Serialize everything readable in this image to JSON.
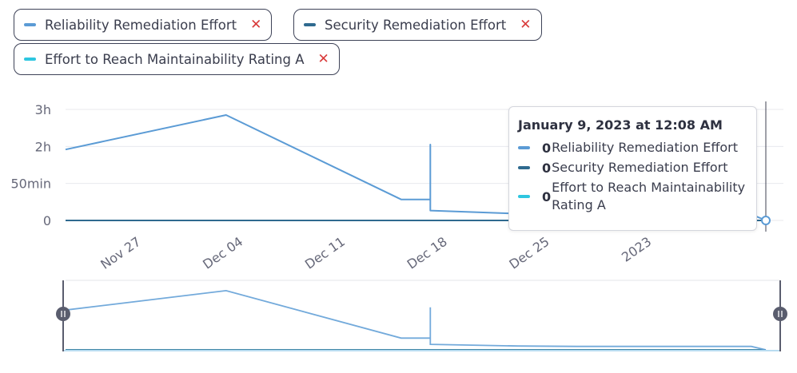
{
  "filters": [
    {
      "label": "Reliability Remediation Effort",
      "color": "#5b9bd5",
      "remove": "✕"
    },
    {
      "label": "Security Remediation Effort",
      "color": "#2f6a8f",
      "remove": "✕"
    },
    {
      "label": "Effort to Reach Maintainability Rating A",
      "color": "#2ec6e0",
      "remove": "✕"
    }
  ],
  "tooltip": {
    "title": "January 9, 2023 at 12:08 AM",
    "rows": [
      {
        "value": "0",
        "label": "Reliability Remediation Effort",
        "color": "#5b9bd5"
      },
      {
        "value": "0",
        "label": "Security Remediation Effort",
        "color": "#2f6a8f"
      },
      {
        "value": "0",
        "label": "Effort to Reach Maintainability Rating A",
        "color": "#2ec6e0"
      }
    ]
  },
  "chart_data": {
    "type": "line",
    "x_range": [
      "2022-11-22",
      "2023-01-09"
    ],
    "y_ticks": [
      {
        "label": "3h",
        "value": 180
      },
      {
        "label": "2h",
        "value": 120
      },
      {
        "label": "50min",
        "value": 60
      },
      {
        "label": "0",
        "value": 0
      }
    ],
    "y_range_minutes": [
      0,
      180
    ],
    "x_ticks": [
      {
        "label": "Nov 27",
        "date": "2022-11-27"
      },
      {
        "label": "Dec 04",
        "date": "2022-12-04"
      },
      {
        "label": "Dec 11",
        "date": "2022-12-11"
      },
      {
        "label": "Dec 18",
        "date": "2022-12-18"
      },
      {
        "label": "Dec 25",
        "date": "2022-12-25"
      },
      {
        "label": "2023",
        "date": "2023-01-01"
      }
    ],
    "grid": true,
    "series": [
      {
        "name": "Reliability Remediation Effort",
        "color": "#5b9bd5",
        "points": [
          [
            "2022-11-22",
            115
          ],
          [
            "2022-12-03",
            171
          ],
          [
            "2022-12-15",
            34
          ],
          [
            "2022-12-17",
            34
          ],
          [
            "2022-12-17",
            123
          ],
          [
            "2022-12-17",
            16
          ],
          [
            "2022-12-23",
            11
          ],
          [
            "2022-12-27",
            10
          ],
          [
            "2023-01-02",
            10
          ],
          [
            "2023-01-08",
            10
          ],
          [
            "2023-01-09",
            0
          ]
        ]
      },
      {
        "name": "Security Remediation Effort",
        "color": "#2f6a8f",
        "points": [
          [
            "2022-11-22",
            0
          ],
          [
            "2023-01-09",
            0
          ]
        ]
      },
      {
        "name": "Effort to Reach Maintainability Rating A",
        "color": "#2ec6e0",
        "points": [
          [
            "2022-11-22",
            0
          ],
          [
            "2023-01-09",
            0
          ]
        ]
      }
    ],
    "hover_date": "2023-01-09"
  }
}
